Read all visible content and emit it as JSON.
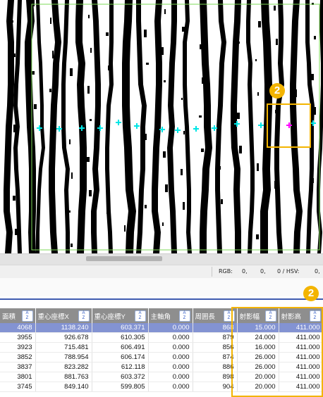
{
  "status": {
    "rgb_label": "RGB:",
    "rgb_r": "0,",
    "rgb_g": "0,",
    "hsv_label": "0 / HSV:",
    "hsv_v": "0,"
  },
  "callout_badge": "2",
  "colors": {
    "callout": "#f3b400",
    "header": "#8e8e8e",
    "selected_row": "#8393d2",
    "roi": "#7ed957",
    "centroid": "#00e5e5",
    "selected_centroid": "#ff00ff"
  },
  "columns": [
    {
      "label": "面積"
    },
    {
      "label": "重心座標X"
    },
    {
      "label": "重心座標Y"
    },
    {
      "label": "主軸角"
    },
    {
      "label": "周囲長"
    },
    {
      "label": "射影幅"
    },
    {
      "label": "射影高"
    }
  ],
  "rows": [
    [
      "4068",
      "1138.240",
      "603.371",
      "0.000",
      "868",
      "15.000",
      "411.000"
    ],
    [
      "3955",
      "926.678",
      "610.305",
      "0.000",
      "879",
      "24.000",
      "411.000"
    ],
    [
      "3923",
      "715.481",
      "606.491",
      "0.000",
      "856",
      "16.000",
      "411.000"
    ],
    [
      "3852",
      "788.954",
      "606.174",
      "0.000",
      "874",
      "26.000",
      "411.000"
    ],
    [
      "3837",
      "823.282",
      "612.118",
      "0.000",
      "886",
      "26.000",
      "411.000"
    ],
    [
      "3801",
      "881.763",
      "603.372",
      "0.000",
      "898",
      "20.000",
      "411.000"
    ],
    [
      "3745",
      "849.140",
      "599.805",
      "0.000",
      "904",
      "20.000",
      "411.000"
    ]
  ],
  "sort_icon": "sort-az-icon"
}
